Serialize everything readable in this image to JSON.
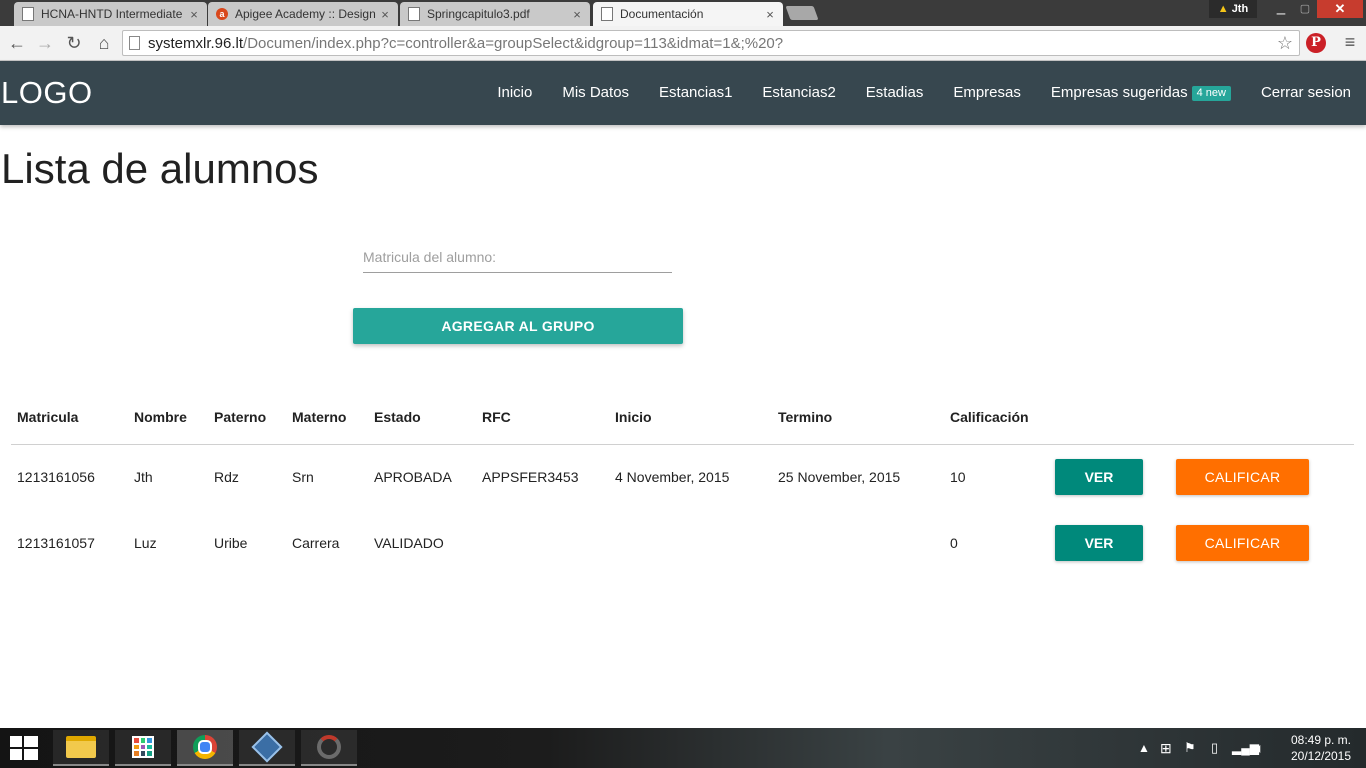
{
  "browser": {
    "tabs": [
      {
        "label": "HCNA-HNTD Intermediate",
        "close": "×"
      },
      {
        "label": "Apigee Academy :: Design",
        "close": "×"
      },
      {
        "label": "Springcapitulo3.pdf",
        "close": "×"
      },
      {
        "label": "Documentación",
        "close": "×"
      }
    ],
    "profile_name": "Jth",
    "url_host": "systemxlr.96.lt",
    "url_path": "/Documen/index.php?c=controller&a=groupSelect&idgroup=113&idmat=1&;%20?"
  },
  "navbar": {
    "logo": "LOGO",
    "links": [
      "Inicio",
      "Mis Datos",
      "Estancias1",
      "Estancias2",
      "Estadias",
      "Empresas",
      "Empresas sugeridas",
      "Cerrar sesion"
    ],
    "badge": "4 new"
  },
  "page": {
    "title": "Lista de alumnos",
    "search_placeholder": "Matricula del alumno:",
    "add_button": "AGREGAR AL GRUPO"
  },
  "table": {
    "headers": [
      "Matricula",
      "Nombre",
      "Paterno",
      "Materno",
      "Estado",
      "RFC",
      "Inicio",
      "Termino",
      "Calificación"
    ],
    "rows": [
      {
        "matricula": "1213161056",
        "nombre": "Jth",
        "paterno": "Rdz",
        "materno": "Srn",
        "estado": "APROBADA",
        "rfc": "APPSFER3453",
        "inicio": "4 November, 2015",
        "termino": "25 November, 2015",
        "calificacion": "10",
        "ver": "VER",
        "calificar": "CALIFICAR"
      },
      {
        "matricula": "1213161057",
        "nombre": "Luz",
        "paterno": "Uribe",
        "materno": "Carrera",
        "estado": "VALIDADO",
        "rfc": "",
        "inicio": "",
        "termino": "",
        "calificacion": "0",
        "ver": "VER",
        "calificar": "CALIFICAR"
      }
    ]
  },
  "taskbar": {
    "time": "08:49 p. m.",
    "date": "20/12/2015"
  },
  "colors": {
    "navbar": "#37474f",
    "teal": "#26a69a",
    "ver_button": "#00897b",
    "calificar_button": "#ff6f00"
  }
}
